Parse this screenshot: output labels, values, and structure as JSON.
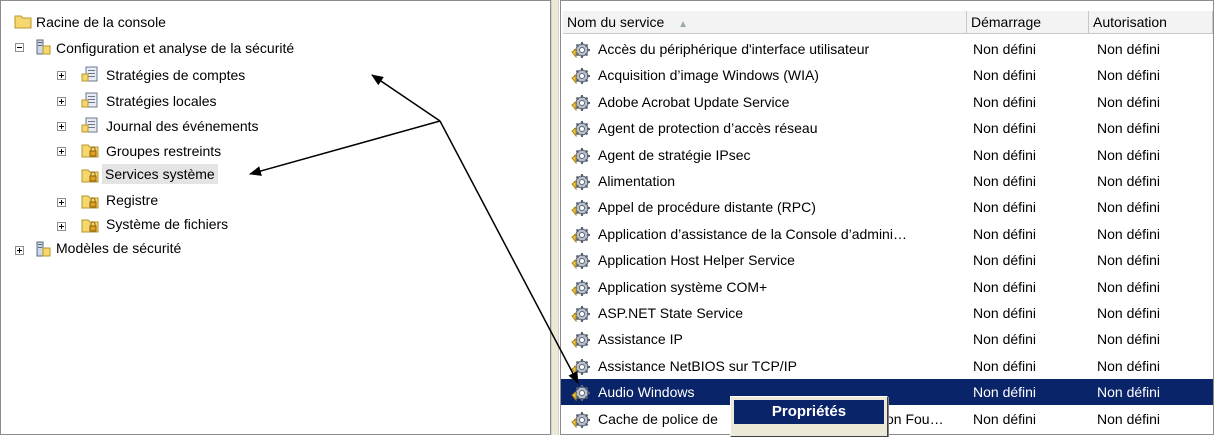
{
  "tree": {
    "items": [
      {
        "label": "Racine de la console",
        "icon": "folder-icon"
      },
      {
        "label": "Configuration et analyse de la sécurité",
        "icon": "security-db-icon"
      },
      {
        "label": "Stratégies de comptes",
        "icon": "policy-icon"
      },
      {
        "label": "Stratégies locales",
        "icon": "policy-icon"
      },
      {
        "label": "Journal des événements",
        "icon": "policy-icon"
      },
      {
        "label": "Groupes restreints",
        "icon": "locked-folder-icon"
      },
      {
        "label": "Services système",
        "icon": "locked-folder-icon"
      },
      {
        "label": "Registre",
        "icon": "locked-folder-icon"
      },
      {
        "label": "Système de fichiers",
        "icon": "locked-folder-icon"
      },
      {
        "label": "Modèles de sécurité",
        "icon": "security-db-icon"
      }
    ],
    "selected": "Services système"
  },
  "list": {
    "headers": {
      "name": "Nom du service",
      "startup": "Démarrage",
      "permission": "Autorisation"
    },
    "sort_indicator": "▲",
    "rows": [
      {
        "name": "Accès du périphérique d'interface utilisateur",
        "startup": "Non défini",
        "permission": "Non défini"
      },
      {
        "name": "Acquisition d’image Windows (WIA)",
        "startup": "Non défini",
        "permission": "Non défini"
      },
      {
        "name": "Adobe Acrobat Update Service",
        "startup": "Non défini",
        "permission": "Non défini"
      },
      {
        "name": "Agent de protection d’accès réseau",
        "startup": "Non défini",
        "permission": "Non défini"
      },
      {
        "name": "Agent de stratégie IPsec",
        "startup": "Non défini",
        "permission": "Non défini"
      },
      {
        "name": "Alimentation",
        "startup": "Non défini",
        "permission": "Non défini"
      },
      {
        "name": "Appel de procédure distante (RPC)",
        "startup": "Non défini",
        "permission": "Non défini"
      },
      {
        "name": "Application d’assistance de la Console d’admini…",
        "startup": "Non défini",
        "permission": "Non défini"
      },
      {
        "name": "Application Host Helper Service",
        "startup": "Non défini",
        "permission": "Non défini"
      },
      {
        "name": "Application système COM+",
        "startup": "Non défini",
        "permission": "Non défini"
      },
      {
        "name": "ASP.NET State Service",
        "startup": "Non défini",
        "permission": "Non défini"
      },
      {
        "name": "Assistance IP",
        "startup": "Non défini",
        "permission": "Non défini"
      },
      {
        "name": "Assistance NetBIOS sur TCP/IP",
        "startup": "Non défini",
        "permission": "Non défini"
      },
      {
        "name": "Audio Windows",
        "startup": "Non défini",
        "permission": "Non défini"
      },
      {
        "name": "Cache de police de",
        "name_tail": "on Fou…",
        "startup": "Non défini",
        "permission": "Non défini"
      }
    ],
    "selected_row": "Audio Windows"
  },
  "context_menu": {
    "items": [
      "Propriétés"
    ]
  },
  "colors": {
    "selection": "#0a246a",
    "tree_selection": "#e4e4e4",
    "icon_gold": "#e8c44a"
  }
}
